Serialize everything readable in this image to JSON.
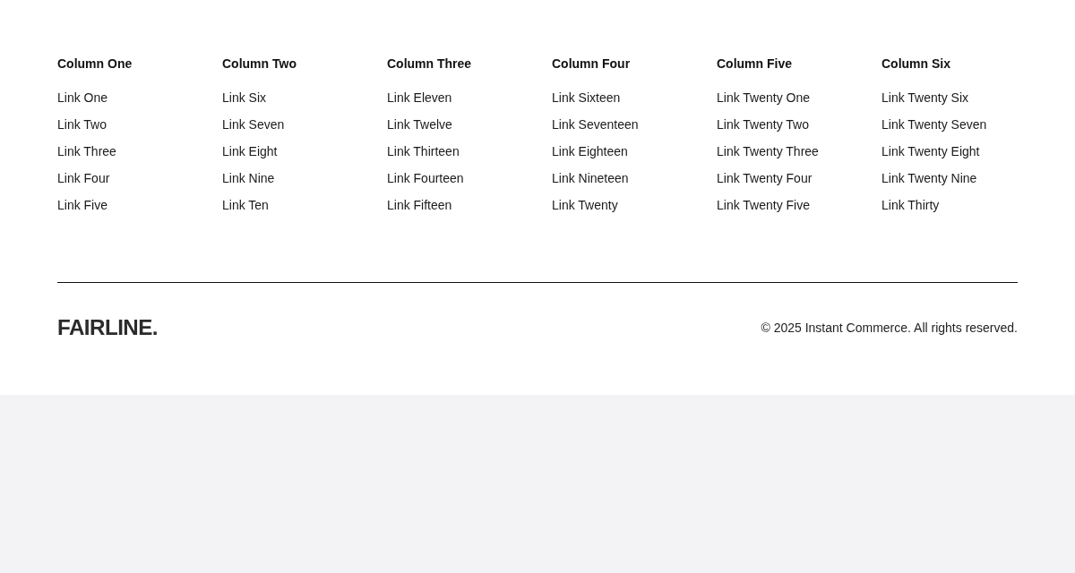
{
  "footer": {
    "columns": [
      {
        "heading": "Column One",
        "links": [
          "Link One",
          "Link Two",
          "Link Three",
          "Link Four",
          "Link Five"
        ]
      },
      {
        "heading": "Column Two",
        "links": [
          "Link Six",
          "Link Seven",
          "Link Eight",
          "Link Nine",
          "Link Ten"
        ]
      },
      {
        "heading": "Column Three",
        "links": [
          "Link Eleven",
          "Link Twelve",
          "Link Thirteen",
          "Link Fourteen",
          "Link Fifteen"
        ]
      },
      {
        "heading": "Column Four",
        "links": [
          "Link Sixteen",
          "Link Seventeen",
          "Link Eighteen",
          "Link Nineteen",
          "Link Twenty"
        ]
      },
      {
        "heading": "Column Five",
        "links": [
          "Link Twenty One",
          "Link Twenty Two",
          "Link Twenty Three",
          "Link Twenty Four",
          "Link Twenty Five"
        ]
      },
      {
        "heading": "Column Six",
        "links": [
          "Link Twenty Six",
          "Link Twenty Seven",
          "Link Twenty Eight",
          "Link Twenty Nine",
          "Link Thirty"
        ]
      }
    ],
    "logo": "FAIRLINE.",
    "copyright": "© 2025 Instant Commerce. All rights reserved."
  }
}
